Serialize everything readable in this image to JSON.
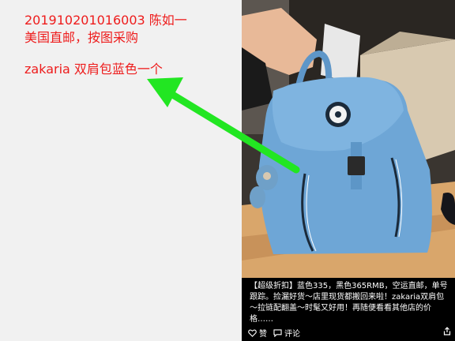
{
  "notes": {
    "line1": "201910201016003    陈如一",
    "line2": "美国直邮，按图采购",
    "line3": "zakaria 双肩包蓝色一个"
  },
  "post": {
    "caption": "【超级折扣】蓝色335，黑色365RMB，空运直邮，单号跟踪。捡漏好货～店里现货都搬回来啦！zakaria双肩包～拉链配翻盖～时髦又好用！再随便看看其他店的价格……",
    "like_label": "赞",
    "comment_label": "评论",
    "like_icon": "heart-icon",
    "comment_icon": "comment-icon",
    "share_icon": "share-icon"
  },
  "colors": {
    "note_red": "#ee1c1c",
    "arrow_green": "#22e622",
    "bag_blue": "#6ea6d6"
  }
}
